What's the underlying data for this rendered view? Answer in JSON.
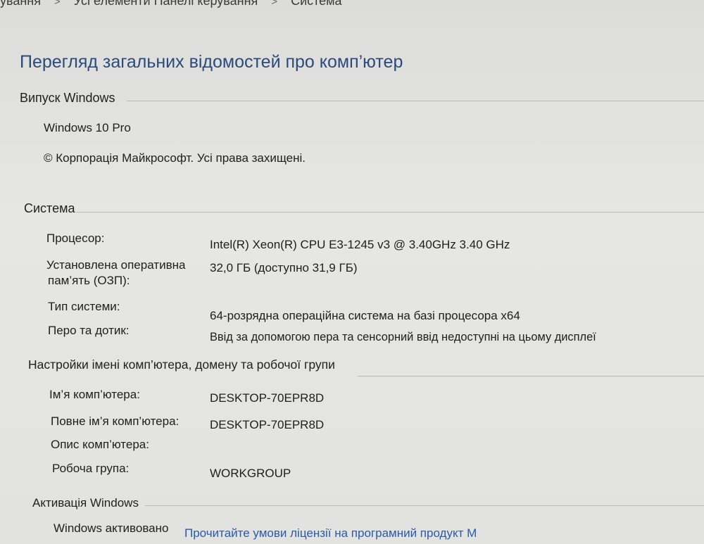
{
  "breadcrumb": {
    "items": [
      "ування",
      "Усі елементи Панелі керування",
      "Система"
    ],
    "separator": ">"
  },
  "page_title": "Перегляд загальних відомостей про комп’ютер",
  "windows_edition": {
    "title": "Випуск Windows",
    "edition": "Windows 10 Pro",
    "copyright": "© Корпорація Майкрософт. Усі права захищені."
  },
  "system": {
    "title": "Система",
    "processor_label": "Процесор:",
    "processor_value": "Intel(R) Xeon(R) CPU E3-1245 v3 @ 3.40GHz   3.40 GHz",
    "ram_label_line1": "Установлена оперативна",
    "ram_label_line2": "пам’ять (ОЗП):",
    "ram_value": "32,0 ГБ (доступно 31,9 ГБ)",
    "system_type_label": "Тип системи:",
    "system_type_value": "64-розрядна операційна система на базі процесора x64",
    "pen_touch_label": "Перо та дотик:",
    "pen_touch_value": "Ввід за допомогою пера та сенсорний ввід недоступні на цьому дисплеї"
  },
  "computer_name": {
    "title": "Настройки імені комп’ютера, домену та робочої групи",
    "name_label": "Ім’я комп’ютера:",
    "name_value": "DESKTOP-70EPR8D",
    "full_name_label": "Повне ім’я комп’ютера:",
    "full_name_value": "DESKTOP-70EPR8D",
    "description_label": "Опис комп’ютера:",
    "description_value": "",
    "workgroup_label": "Робоча група:",
    "workgroup_value": "WORKGROUP"
  },
  "activation": {
    "title": "Активація Windows",
    "status": "Windows активовано",
    "license_link": "Прочитайте умови ліцензії на програмний продукт М"
  }
}
